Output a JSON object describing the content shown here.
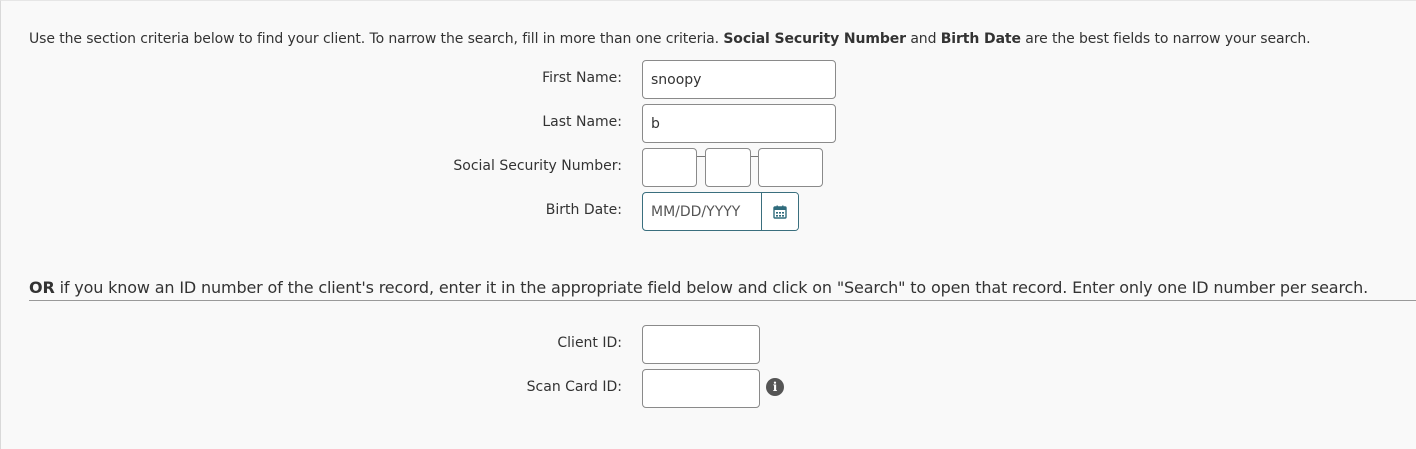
{
  "instructions": {
    "part1": "Use the section criteria below to find your client. To narrow the search, fill in more than one criteria.",
    "bold1": "Social Security Number",
    "part2": "and",
    "bold2": "Birth Date",
    "part3": "are the best fields to narrow your search."
  },
  "fields": {
    "first_name": {
      "label": "First Name:",
      "value": "snoopy"
    },
    "last_name": {
      "label": "Last Name:",
      "value": "b"
    },
    "ssn": {
      "label": "Social Security Number:",
      "part1": "",
      "part2": "",
      "part3": ""
    },
    "birth_date": {
      "label": "Birth Date:",
      "value": "",
      "placeholder": "MM/DD/YYYY",
      "icon": "calendar-icon"
    }
  },
  "id_section": {
    "or_bold": "OR",
    "text": "if you know an ID number of the client's record, enter it in the appropriate field below and click on \"Search\" to open that record. Enter only one ID number per search.",
    "client_id": {
      "label": "Client ID:",
      "value": ""
    },
    "scan_card_id": {
      "label": "Scan Card ID:",
      "value": "",
      "info_icon": "info-icon",
      "info_glyph": "i"
    }
  },
  "colors": {
    "background": "#f9f9f9",
    "input_border": "#8a8a8a",
    "date_border": "#3a6f7e",
    "calendar_icon": "#2f6b7c",
    "info_icon_bg": "#555555"
  }
}
